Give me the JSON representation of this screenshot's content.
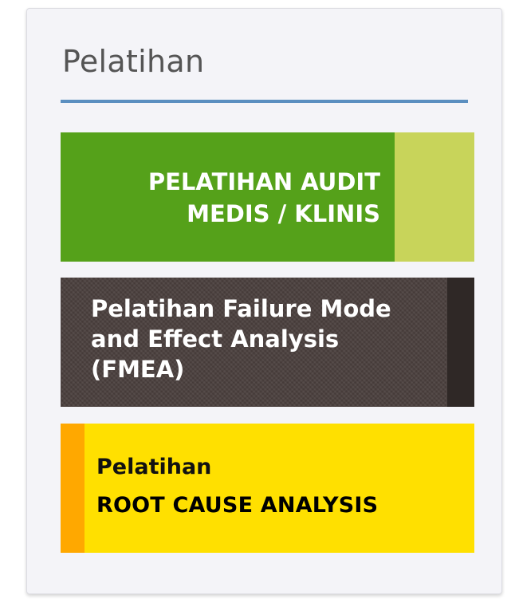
{
  "widget": {
    "title": "Pelatihan",
    "accent_color": "#5b8fc0"
  },
  "banners": [
    {
      "lines": [
        "PELATIHAN AUDIT",
        "MEDIS / KLINIS"
      ],
      "background": "#55a11a",
      "side_color": "#c8d45a"
    },
    {
      "lines": [
        "Pelatihan Failure Mode",
        "and Effect Analysis",
        "(FMEA)"
      ],
      "background": "#4a3f3d",
      "side_color": "#2f2826"
    },
    {
      "lines": [
        "Pelatihan",
        "ROOT CAUSE ANALYSIS"
      ],
      "background": "#ffe000",
      "side_color": "#ffa800"
    }
  ]
}
